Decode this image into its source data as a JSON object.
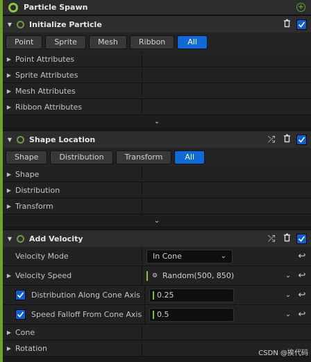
{
  "spawn": {
    "title": "Particle Spawn"
  },
  "init": {
    "title": "Initialize Particle",
    "tabs": [
      "Point",
      "Sprite",
      "Mesh",
      "Ribbon",
      "All"
    ],
    "active_tab": "All",
    "rows": [
      "Point Attributes",
      "Sprite Attributes",
      "Mesh Attributes",
      "Ribbon Attributes"
    ]
  },
  "shape": {
    "title": "Shape Location",
    "tabs": [
      "Shape",
      "Distribution",
      "Transform",
      "All"
    ],
    "active_tab": "All",
    "rows": [
      "Shape",
      "Distribution",
      "Transform"
    ]
  },
  "velocity": {
    "title": "Add Velocity",
    "mode_label": "Velocity Mode",
    "mode_value": "In Cone",
    "speed_label": "Velocity Speed",
    "speed_value": "Random(500, 850)",
    "dist_label": "Distribution Along Cone Axis",
    "dist_value": "0.25",
    "falloff_label": "Speed Falloff From Cone Axis",
    "falloff_value": "0.5",
    "cone_label": "Cone",
    "rotation_label": "Rotation"
  },
  "watermark": "CSDN @挨代码",
  "colors": {
    "accent": "#0e6ad6",
    "green": "#8ec63f"
  }
}
